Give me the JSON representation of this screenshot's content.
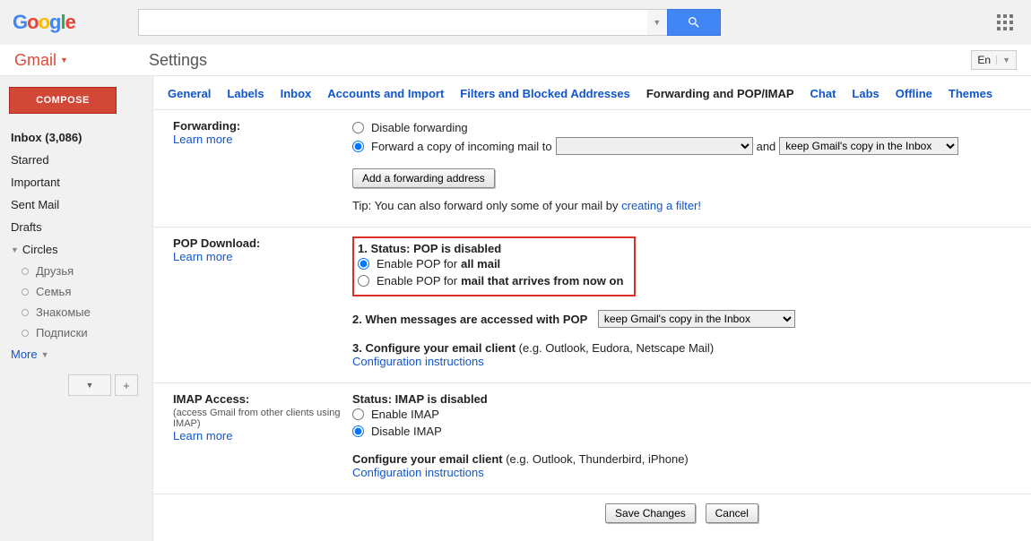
{
  "top": {
    "search_placeholder": "",
    "search_value": ""
  },
  "sub": {
    "app": "Gmail",
    "title": "Settings",
    "lang": "En"
  },
  "sidebar": {
    "compose": "COMPOSE",
    "inbox": "Inbox (3,086)",
    "items": [
      "Starred",
      "Important",
      "Sent Mail",
      "Drafts"
    ],
    "circles": "Circles",
    "circle_items": [
      "Друзья",
      "Семья",
      "Знакомые",
      "Подписки"
    ],
    "more": "More",
    "plus": "+"
  },
  "tabs": [
    "General",
    "Labels",
    "Inbox",
    "Accounts and Import",
    "Filters and Blocked Addresses",
    "Forwarding and POP/IMAP",
    "Chat",
    "Labs",
    "Offline",
    "Themes"
  ],
  "active_tab": "Forwarding and POP/IMAP",
  "fwd": {
    "label": "Forwarding:",
    "learn": "Learn more",
    "opt_disable": "Disable forwarding",
    "opt_forward": "Forward a copy of incoming mail to",
    "email_selected": "",
    "and": "and",
    "action_selected": "keep Gmail's copy in the Inbox",
    "add_btn": "Add a forwarding address",
    "tip_prefix": "Tip: You can also forward only some of your mail by ",
    "tip_link": "creating a filter!"
  },
  "pop": {
    "label": "POP Download:",
    "learn": "Learn more",
    "status": "1. Status: POP is disabled",
    "opt_all_pre": "Enable POP for ",
    "opt_all_b": "all mail",
    "opt_new_pre": "Enable POP for ",
    "opt_new_b": "mail that arrives from now on",
    "step2": "2. When messages are accessed with POP",
    "step2_sel": "keep Gmail's copy in the Inbox",
    "step3_pre": "3. Configure your email client ",
    "step3_eg": "(e.g. Outlook, Eudora, Netscape Mail)",
    "step3_link": "Configuration instructions"
  },
  "imap": {
    "label": "IMAP Access:",
    "sub": "(access Gmail from other clients using IMAP)",
    "learn": "Learn more",
    "status": "Status: IMAP is disabled",
    "opt_enable": "Enable IMAP",
    "opt_disable": "Disable IMAP",
    "conf_pre": "Configure your email client ",
    "conf_eg": "(e.g. Outlook, Thunderbird, iPhone)",
    "conf_link": "Configuration instructions"
  },
  "buttons": {
    "save": "Save Changes",
    "cancel": "Cancel"
  }
}
